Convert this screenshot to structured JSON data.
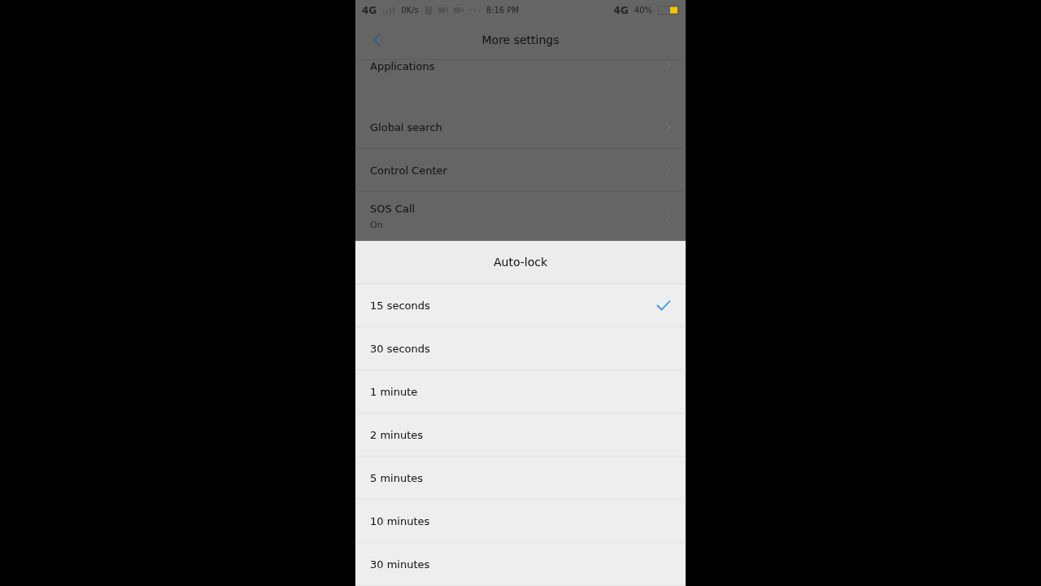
{
  "status_bar": {
    "network": "4G",
    "speed": "0K/s",
    "time": "8:16 PM",
    "network_right": "4G",
    "battery": "40%"
  },
  "header": {
    "title": "More settings"
  },
  "settings_items": [
    {
      "label": "Applications"
    },
    {
      "label": "Global search"
    },
    {
      "label": "Control Center"
    },
    {
      "label": "SOS Call",
      "subtitle": "On"
    }
  ],
  "sheet": {
    "title": "Auto-lock",
    "options": [
      {
        "label": "15 seconds",
        "selected": true
      },
      {
        "label": "30 seconds",
        "selected": false
      },
      {
        "label": "1 minute",
        "selected": false
      },
      {
        "label": "2 minutes",
        "selected": false
      },
      {
        "label": "5 minutes",
        "selected": false
      },
      {
        "label": "10 minutes",
        "selected": false
      },
      {
        "label": "30 minutes",
        "selected": false
      }
    ]
  }
}
